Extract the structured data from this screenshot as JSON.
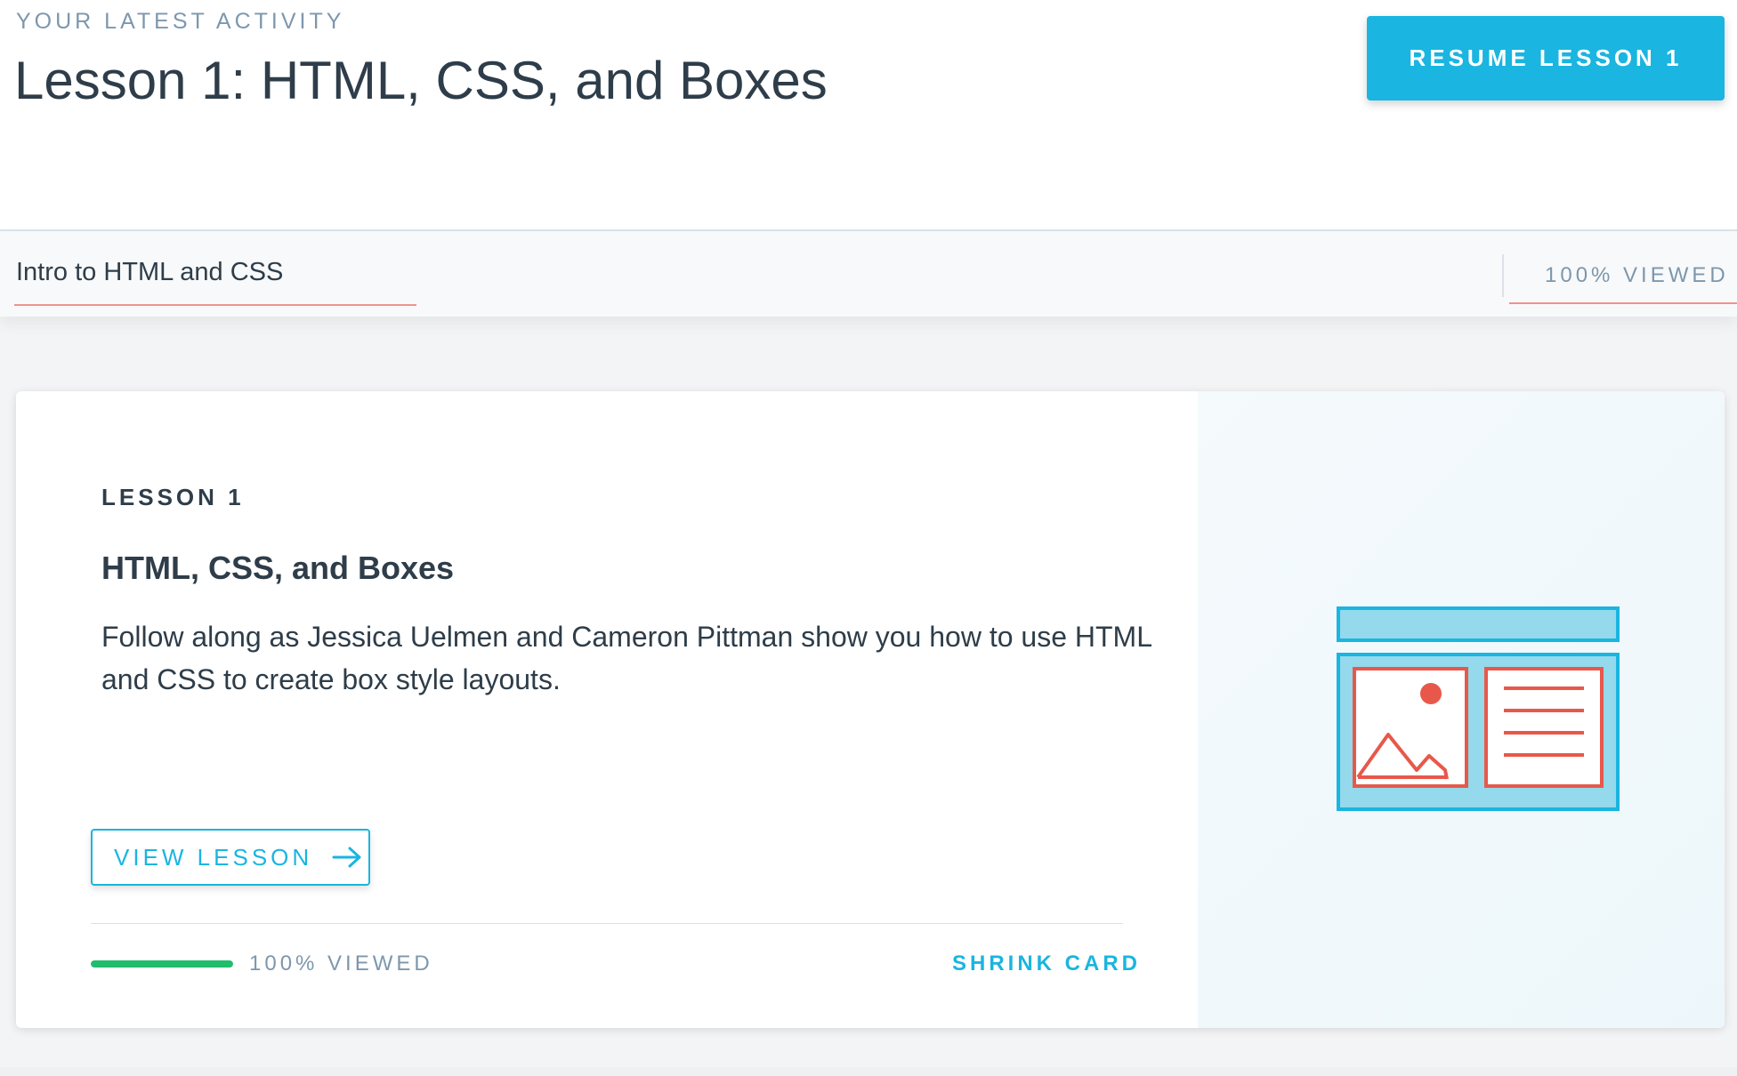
{
  "header": {
    "eyebrow": "YOUR LATEST ACTIVITY",
    "title": "Lesson 1: HTML, CSS, and Boxes",
    "resume_label": "RESUME LESSON 1"
  },
  "subbar": {
    "concept": "Intro to HTML and CSS",
    "viewed": "100% VIEWED"
  },
  "card": {
    "kicker": "LESSON 1",
    "title": "HTML, CSS, and Boxes",
    "description": "Follow along as Jessica Uelmen and Cameron Pittman show you how to use HTML and CSS to create box style layouts.",
    "view_label": "VIEW LESSON",
    "progress_fraction": 1.0,
    "viewed": "100% VIEWED",
    "shrink_label": "SHRINK CARD",
    "illustration_icon": "webpage-layout-icon",
    "arrow_icon": "arrow-right-icon"
  },
  "colors": {
    "accent": "#1ab5e0",
    "progress": "#1fbd6c",
    "underline": "#f0928a",
    "muted": "#7d97ad",
    "text": "#2e3d49",
    "illustration_red": "#e8584a",
    "illustration_blue_fill": "#94d9ec"
  }
}
